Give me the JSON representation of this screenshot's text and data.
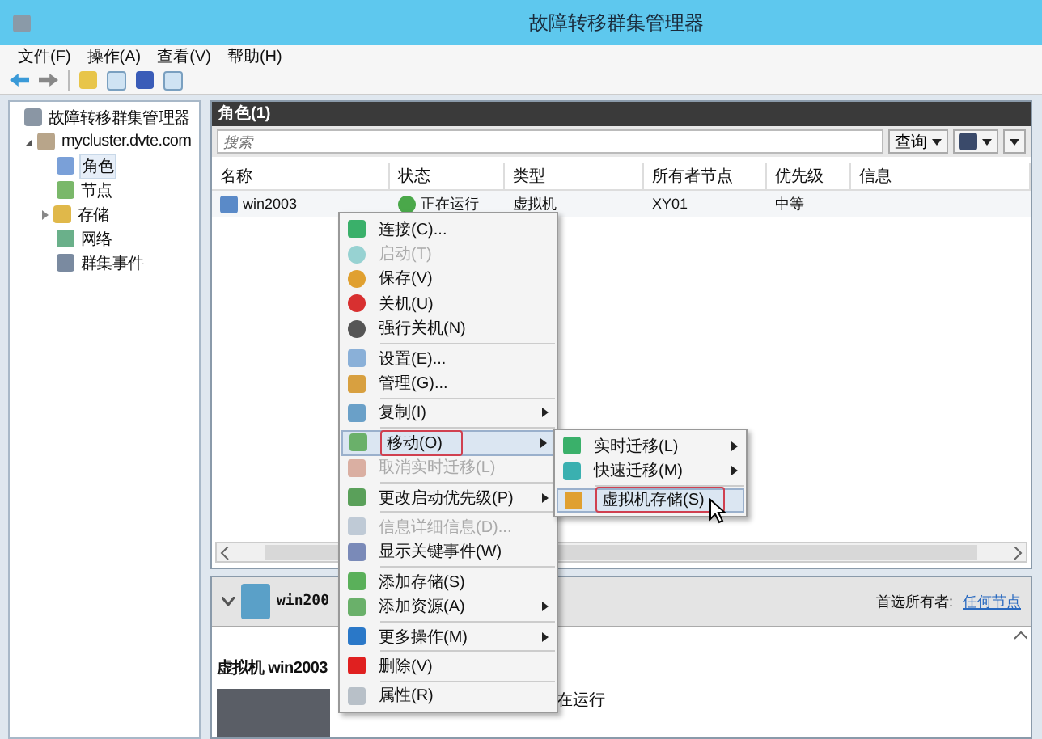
{
  "window": {
    "title": "故障转移群集管理器"
  },
  "menu_bar": [
    "文件(F)",
    "操作(A)",
    "查看(V)",
    "帮助(H)"
  ],
  "tree": [
    {
      "label": "故障转移群集管理器",
      "selected": false,
      "children": [
        {
          "label": "mycluster.dvte.com",
          "selected": false,
          "expanded": true,
          "children": [
            {
              "label": "角色",
              "selected": true
            },
            {
              "label": "节点",
              "selected": false
            },
            {
              "label": "存储",
              "selected": false,
              "expanded": false
            },
            {
              "label": "网络",
              "selected": false
            },
            {
              "label": "群集事件",
              "selected": false
            }
          ]
        }
      ]
    }
  ],
  "roles_panel": {
    "title": "角色(1)",
    "search": {
      "placeholder": "搜索"
    },
    "query_button": "查询",
    "columns": [
      "名称",
      "状态",
      "类型",
      "所有者节点",
      "优先级",
      "信息"
    ],
    "rows": [
      {
        "name": "win2003",
        "status": "正在运行",
        "type": "虚拟机",
        "owner": "XY01",
        "priority": "中等",
        "selected": false
      }
    ]
  },
  "context_menu": [
    {
      "kind": "item",
      "label": "连接(C)...",
      "disabled": false,
      "submenu": false,
      "selected": false
    },
    {
      "kind": "item",
      "label": "启动(T)",
      "disabled": true,
      "submenu": false,
      "selected": false
    },
    {
      "kind": "item",
      "label": "保存(V)",
      "disabled": false,
      "submenu": false,
      "selected": false
    },
    {
      "kind": "item",
      "label": "关机(U)",
      "disabled": false,
      "submenu": false,
      "selected": false
    },
    {
      "kind": "item",
      "label": "强行关机(N)",
      "disabled": false,
      "submenu": false,
      "selected": false
    },
    {
      "kind": "separator"
    },
    {
      "kind": "item",
      "label": "设置(E)...",
      "disabled": false,
      "submenu": false,
      "selected": false
    },
    {
      "kind": "item",
      "label": "管理(G)...",
      "disabled": false,
      "submenu": false,
      "selected": false
    },
    {
      "kind": "separator"
    },
    {
      "kind": "item",
      "label": "复制(I)",
      "disabled": false,
      "submenu": true,
      "selected": false
    },
    {
      "kind": "separator"
    },
    {
      "kind": "item",
      "label": "移动(O)",
      "disabled": false,
      "submenu": true,
      "selected": true
    },
    {
      "kind": "item",
      "label": "取消实时迁移(L)",
      "disabled": true,
      "submenu": false,
      "selected": false
    },
    {
      "kind": "separator"
    },
    {
      "kind": "item",
      "label": "更改启动优先级(P)",
      "disabled": false,
      "submenu": true,
      "selected": false
    },
    {
      "kind": "separator"
    },
    {
      "kind": "item",
      "label": "信息详细信息(D)...",
      "disabled": true,
      "submenu": false,
      "selected": false
    },
    {
      "kind": "item",
      "label": "显示关键事件(W)",
      "disabled": false,
      "submenu": false,
      "selected": false
    },
    {
      "kind": "separator"
    },
    {
      "kind": "item",
      "label": "添加存储(S)",
      "disabled": false,
      "submenu": false,
      "selected": false
    },
    {
      "kind": "item",
      "label": "添加资源(A)",
      "disabled": false,
      "submenu": true,
      "selected": false
    },
    {
      "kind": "separator"
    },
    {
      "kind": "item",
      "label": "更多操作(M)",
      "disabled": false,
      "submenu": true,
      "selected": false
    },
    {
      "kind": "separator"
    },
    {
      "kind": "item",
      "label": "删除(V)",
      "disabled": false,
      "submenu": false,
      "selected": false
    },
    {
      "kind": "separator"
    },
    {
      "kind": "item",
      "label": "属性(R)",
      "disabled": false,
      "submenu": false,
      "selected": false
    }
  ],
  "submenu": [
    {
      "kind": "item",
      "label": "实时迁移(L)",
      "disabled": false,
      "submenu": true,
      "selected": false
    },
    {
      "kind": "item",
      "label": "快速迁移(M)",
      "disabled": false,
      "submenu": true,
      "selected": false
    },
    {
      "kind": "separator"
    },
    {
      "kind": "item",
      "label": "虚拟机存储(S)",
      "disabled": false,
      "submenu": false,
      "selected": true
    }
  ],
  "details_panel": {
    "name": "win200",
    "preferred_owners_label": "首选所有者:",
    "preferred_owners_link": "任何节点",
    "heading": "虚拟机 win2003",
    "status_fragment": "在运行"
  }
}
